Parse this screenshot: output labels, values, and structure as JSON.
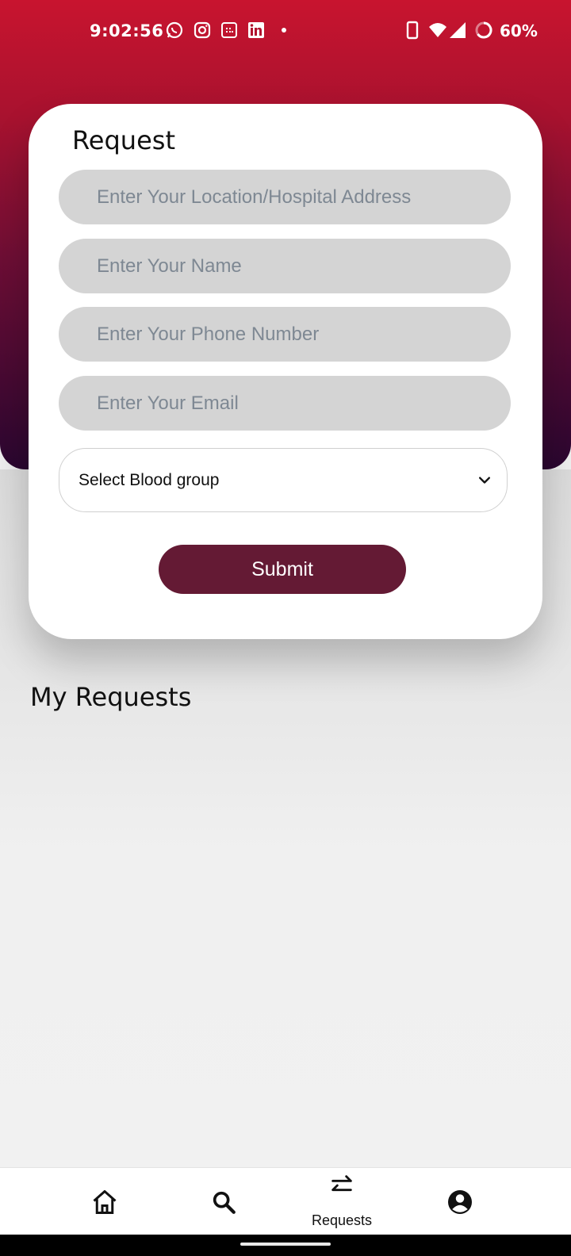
{
  "status_bar": {
    "time": "9:02:56",
    "battery": "60%",
    "notification_icons": [
      "whatsapp-icon",
      "instagram-icon",
      "calendar-icon",
      "linkedin-icon",
      "dot-icon"
    ],
    "system_icons": [
      "phone-icon",
      "wifi-icon",
      "signal-icon",
      "battery-ring-icon"
    ]
  },
  "colors": {
    "header_top": "#c8142f",
    "header_bottom": "#2a0630",
    "submit_bg": "#641a34",
    "field_bg": "#d4d4d4"
  },
  "request_form": {
    "title": "Request",
    "location_placeholder": "Enter Your Location/Hospital Address",
    "name_placeholder": "Enter Your Name",
    "phone_placeholder": "Enter Your Phone Number",
    "email_placeholder": "Enter Your Email",
    "blood_group_label": "Select Blood group",
    "submit_label": "Submit"
  },
  "my_requests": {
    "title": "My Requests"
  },
  "bottom_nav": {
    "items": [
      {
        "icon": "home-icon",
        "label": ""
      },
      {
        "icon": "search-icon",
        "label": ""
      },
      {
        "icon": "swap-arrows-icon",
        "label": "Requests"
      },
      {
        "icon": "account-icon",
        "label": ""
      }
    ]
  }
}
